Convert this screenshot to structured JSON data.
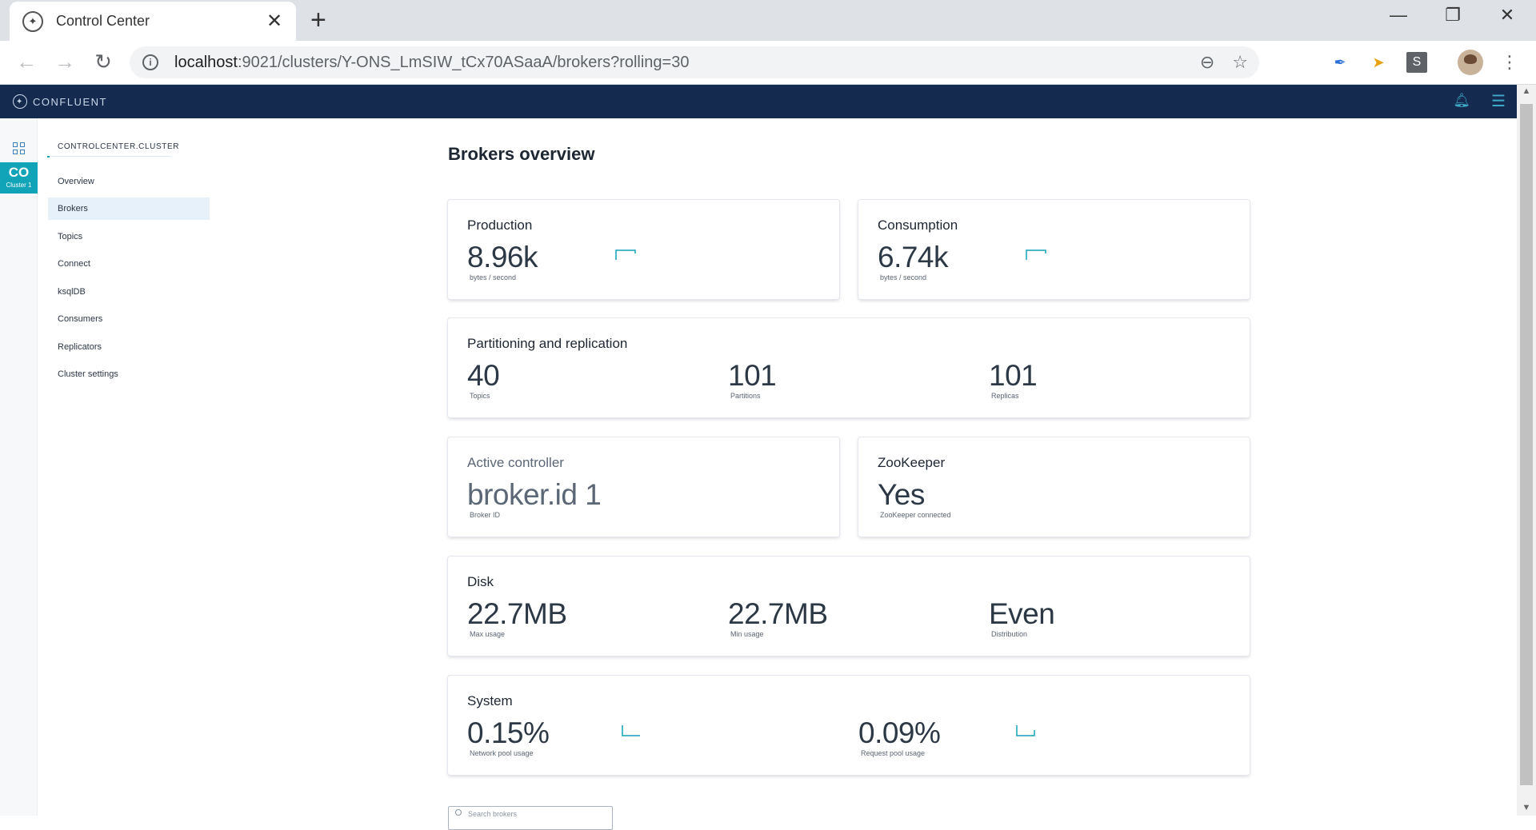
{
  "browser": {
    "tab_title": "Control Center",
    "tab_close": "✕",
    "new_tab": "+",
    "url_host": "localhost",
    "url_path": ":9021/clusters/Y-ONS_LmSIW_tCx70ASaaA/brokers?rolling=30",
    "ext_s_label": "S",
    "window": {
      "minimize": "—",
      "restore": "❐",
      "close": "✕"
    },
    "nav": {
      "back": "←",
      "forward": "→",
      "reload": "↻"
    },
    "icons": [
      "info-icon",
      "zoom-out-icon",
      "star-icon",
      "feather-extension-icon",
      "arrow-extension-icon",
      "s-extension-icon",
      "profile-avatar"
    ]
  },
  "app": {
    "brand": "CONFLUENT",
    "brand_color": "#142b4f",
    "accent_color": "#11a3b8"
  },
  "rail": {
    "cluster_abbr": "CO",
    "cluster_sub": "Cluster 1"
  },
  "sidebar": {
    "cluster_name": "CONTROLCENTER.CLUSTER",
    "items": [
      {
        "label": "Overview",
        "active": false
      },
      {
        "label": "Brokers",
        "active": true
      },
      {
        "label": "Topics",
        "active": false
      },
      {
        "label": "Connect",
        "active": false
      },
      {
        "label": "ksqlDB",
        "active": false
      },
      {
        "label": "Consumers",
        "active": false
      },
      {
        "label": "Replicators",
        "active": false
      },
      {
        "label": "Cluster settings",
        "active": false
      }
    ]
  },
  "main": {
    "title": "Brokers overview",
    "production": {
      "title": "Production",
      "value": "8.96k",
      "unit": "bytes / second"
    },
    "consumption": {
      "title": "Consumption",
      "value": "6.74k",
      "unit": "bytes / second"
    },
    "partitioning": {
      "title": "Partitioning and replication",
      "topics": {
        "value": "40",
        "label": "Topics"
      },
      "partitions": {
        "value": "101",
        "label": "Partitions"
      },
      "replicas": {
        "value": "101",
        "label": "Replicas"
      }
    },
    "controller": {
      "title": "Active controller",
      "value": "broker.id 1",
      "label": "Broker ID"
    },
    "zookeeper": {
      "title": "ZooKeeper",
      "value": "Yes",
      "label": "ZooKeeper connected"
    },
    "disk": {
      "title": "Disk",
      "max": {
        "value": "22.7MB",
        "label": "Max usage"
      },
      "min": {
        "value": "22.7MB",
        "label": "Min usage"
      },
      "distribution": {
        "value": "Even",
        "label": "Distribution"
      }
    },
    "system": {
      "title": "System",
      "network": {
        "value": "0.15%",
        "label": "Network pool usage"
      },
      "request": {
        "value": "0.09%",
        "label": "Request pool usage"
      }
    },
    "search_placeholder": "Search brokers"
  }
}
